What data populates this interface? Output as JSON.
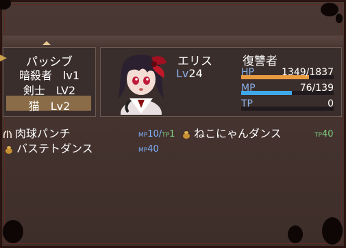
{
  "passive": {
    "title": "パッシブ",
    "lines": [
      "暗殺者　lv1",
      "剣士　LV2",
      "猫　Lv2"
    ]
  },
  "actor": {
    "name": "エリス",
    "class": "復讐者",
    "level_label": "Lv",
    "level": "24",
    "hp": {
      "label": "HP",
      "value": "1349/1837",
      "fraction": 0.734
    },
    "mp": {
      "label": "MP",
      "value": "76/139",
      "fraction": 0.547
    },
    "tp": {
      "label": "TP",
      "value": "0",
      "fraction": 0
    }
  },
  "skills": [
    {
      "name": "肉球パンチ",
      "icon": "claw-icon",
      "cost_mp_tag": "MP",
      "cost_mp": "10",
      "sep": "/",
      "cost_tp_tag": "TP",
      "cost_tp": "1"
    },
    {
      "name": "ねこにゃんダンス",
      "icon": "coin-bag-icon",
      "cost_tp_tag": "TP",
      "cost_tp": "40"
    },
    {
      "name": "バステトダンス",
      "icon": "coin-bag-icon",
      "cost_mp_tag": "MP",
      "cost_mp": "40"
    }
  ],
  "colors": {
    "hp_gauge": "#e89a40",
    "mp_gauge": "#3fa8e8",
    "selection": "#8a6c48",
    "system_label": "#8ab0e8"
  }
}
